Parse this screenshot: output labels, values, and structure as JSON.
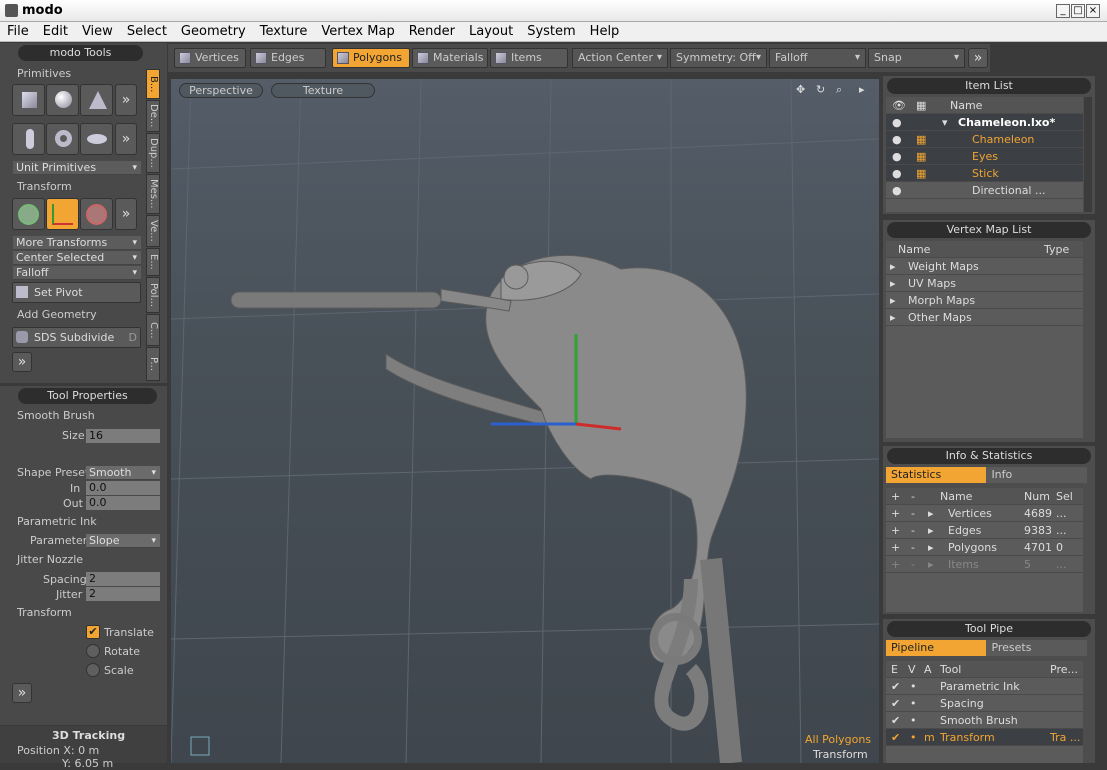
{
  "window": {
    "title": "modo"
  },
  "menu": [
    "File",
    "Edit",
    "View",
    "Select",
    "Geometry",
    "Texture",
    "Vertex Map",
    "Render",
    "Layout",
    "System",
    "Help"
  ],
  "modo_tools": {
    "header": "modo Tools",
    "primitives_label": "Primitives",
    "unit_primitives": "Unit Primitives",
    "transform_label": "Transform",
    "more_transforms": "More Transforms",
    "center_selected": "Center Selected",
    "falloff": "Falloff",
    "set_pivot": "Set Pivot",
    "add_geometry": "Add Geometry",
    "sds_subdivide": "SDS Subdivide",
    "sds_key": "D",
    "vtabs": [
      "B...",
      "De...",
      "Dup...",
      "Mes...",
      "Ve...",
      "E...",
      "Pol...",
      "C...",
      "P..."
    ]
  },
  "tool_properties": {
    "header": "Tool Properties",
    "smooth_brush": "Smooth Brush",
    "size_label": "Size",
    "size_value": "16",
    "shape_preset_label": "Shape Preset",
    "shape_preset_value": "Smooth",
    "in_label": "In",
    "in_value": "0.0",
    "out_label": "Out",
    "out_value": "0.0",
    "parametric_ink": "Parametric Ink",
    "parameter_label": "Parameter",
    "parameter_value": "Slope",
    "jitter_nozzle": "Jitter Nozzle",
    "spacing_label": "Spacing",
    "spacing_value": "2",
    "jitter_label": "Jitter",
    "jitter_value": "2",
    "transform_label": "Transform",
    "translate": "Translate",
    "rotate": "Rotate",
    "scale": "Scale"
  },
  "tracking": {
    "title": "3D Tracking",
    "pos_x": "Position X:  0 m",
    "pos_y": "Y:  6.05 m"
  },
  "toolbar": {
    "modes": [
      "Vertices",
      "Edges",
      "Polygons",
      "Materials",
      "Items"
    ],
    "active_mode": "Polygons",
    "action_center": "Action Center",
    "symmetry": "Symmetry: Off",
    "falloff": "Falloff",
    "snap": "Snap"
  },
  "viewport": {
    "tabs": [
      "Perspective",
      "Texture"
    ],
    "status_selection": "All Polygons",
    "status_tool": "Transform"
  },
  "item_list": {
    "header": "Item List",
    "col_name": "Name",
    "items": [
      {
        "name": "Chameleon.lxo*",
        "bold": true
      },
      {
        "name": "Chameleon",
        "highlight": true
      },
      {
        "name": "Eyes",
        "highlight": true
      },
      {
        "name": "Stick",
        "highlight": true
      },
      {
        "name": "Directional ...",
        "highlight": false
      }
    ]
  },
  "vertex_map_list": {
    "header": "Vertex Map List",
    "col_name": "Name",
    "col_type": "Type",
    "items": [
      "Weight Maps",
      "UV Maps",
      "Morph Maps",
      "Other Maps"
    ]
  },
  "info_stats": {
    "header": "Info & Statistics",
    "tabs": [
      "Statistics",
      "Info"
    ],
    "col_name": "Name",
    "col_num": "Num",
    "col_sel": "Sel",
    "rows": [
      {
        "name": "Vertices",
        "num": "4689",
        "sel": "..."
      },
      {
        "name": "Edges",
        "num": "9383",
        "sel": "..."
      },
      {
        "name": "Polygons",
        "num": "4701",
        "sel": "0"
      },
      {
        "name": "Items",
        "num": "5",
        "sel": "..."
      }
    ]
  },
  "tool_pipe": {
    "header": "Tool Pipe",
    "tabs": [
      "Pipeline",
      "Presets"
    ],
    "cols": [
      "E",
      "V",
      "A",
      "Tool",
      "Pre..."
    ],
    "rows": [
      {
        "tool": "Parametric Ink",
        "a": "",
        "pre": ""
      },
      {
        "tool": "Spacing",
        "a": "",
        "pre": ""
      },
      {
        "tool": "Smooth Brush",
        "a": "",
        "pre": ""
      },
      {
        "tool": "Transform",
        "a": "m",
        "pre": "Tra ..."
      }
    ]
  },
  "colors": {
    "accent": "#f2a532",
    "panel": "#494949",
    "viewport": "#4b535b"
  }
}
